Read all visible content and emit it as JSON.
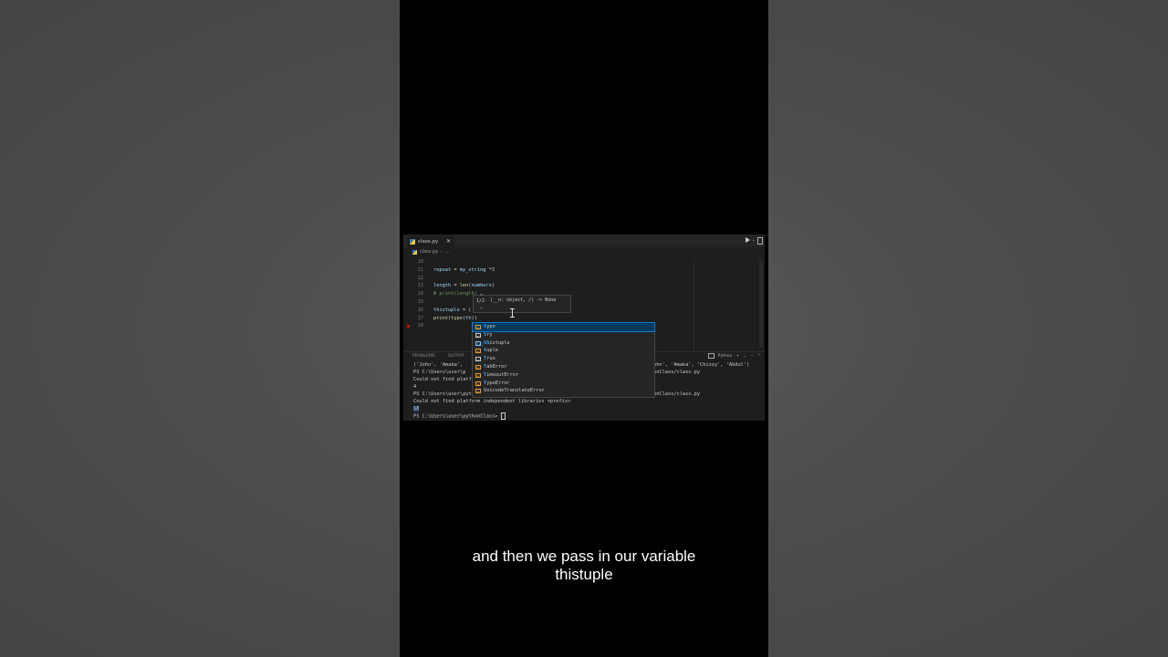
{
  "editor_tab": {
    "filename": "class.py",
    "close_glyph": "✕"
  },
  "breadcrumb": {
    "file": "class.py",
    "sep": "›",
    "rest": "..."
  },
  "toolbar": {
    "chevron": "⌄"
  },
  "code_lines": [
    {
      "num": "10",
      "tokens": []
    },
    {
      "num": "11",
      "tokens": [
        {
          "t": "repeat",
          "c": "kw-var"
        },
        {
          "t": " = ",
          "c": "kw-pl"
        },
        {
          "t": "my_string",
          "c": "kw-var"
        },
        {
          "t": " *",
          "c": "kw-pl"
        },
        {
          "t": "3",
          "c": "kw-num"
        }
      ]
    },
    {
      "num": "12",
      "tokens": []
    },
    {
      "num": "13",
      "tokens": [
        {
          "t": "length",
          "c": "kw-var"
        },
        {
          "t": " = ",
          "c": "kw-pl"
        },
        {
          "t": "len",
          "c": "kw-fn"
        },
        {
          "t": "(",
          "c": "kw-pl"
        },
        {
          "t": "numbers",
          "c": "kw-var"
        },
        {
          "t": ")",
          "c": "kw-pl"
        }
      ]
    },
    {
      "num": "14",
      "tokens": [
        {
          "t": "# print(length)",
          "c": "kw-cm"
        }
      ]
    },
    {
      "num": "15",
      "tokens": []
    },
    {
      "num": "16",
      "tokens": [
        {
          "t": "thistuple",
          "c": "kw-var"
        },
        {
          "t": " = (",
          "c": "kw-pl"
        }
      ]
    },
    {
      "num": "17",
      "tokens": [
        {
          "t": "print",
          "c": "kw-fn"
        },
        {
          "t": "(",
          "c": "kw-pl"
        },
        {
          "t": "type",
          "c": "kw-fn"
        },
        {
          "t": "(",
          "c": "kw-pl"
        },
        {
          "t": "th",
          "c": "kw-var"
        },
        {
          "t": "))",
          "c": "kw-pl"
        }
      ]
    },
    {
      "num": "18",
      "tokens": []
    }
  ],
  "signature_hover": {
    "page": "1/2",
    "up": "^",
    "down": "⌄",
    "signature": "(__o: object, /) -> None"
  },
  "suggestions": [
    {
      "icon": "⊞",
      "kind": "cls",
      "match": "t",
      "rest": "ype",
      "selected": true
    },
    {
      "icon": "≡",
      "kind": "kw",
      "match": "t",
      "rest": "ry",
      "selected": false
    },
    {
      "icon": "[x]",
      "kind": "var",
      "match": "th",
      "rest": "istuple",
      "selected": false
    },
    {
      "icon": "⊞",
      "kind": "cls",
      "match": "t",
      "rest": "uple",
      "selected": false
    },
    {
      "icon": "≡",
      "kind": "kw",
      "match": "T",
      "rest": "rue",
      "selected": false
    },
    {
      "icon": "⊞",
      "kind": "cls",
      "match": "T",
      "rest": "abError",
      "selected": false
    },
    {
      "icon": "⊞",
      "kind": "cls",
      "match": "T",
      "rest": "imeoutError",
      "selected": false
    },
    {
      "icon": "⊞",
      "kind": "cls",
      "match": "T",
      "rest": "ypeError",
      "selected": false
    },
    {
      "icon": "⊞",
      "kind": "cls",
      "match": "",
      "rest": "UnicodeTranslateError",
      "selected": false
    }
  ],
  "panel": {
    "tabs": [
      "PROBLEMS",
      "OUTPUT"
    ],
    "terminal_label": "Python",
    "add": "+",
    "chevron": "⌄",
    "more": "···",
    "collapse": "^"
  },
  "terminal": {
    "lines": [
      "('John', 'Amaka',",
      "PS C:\\Users\\user\\p",
      "Could not find platf",
      "4",
      "PS C:\\Users\\user\\pythonClass>",
      "Could not find platform independent libraries <prefix>",
      "18",
      "PS C:\\Users\\user\\pythonClass>"
    ],
    "right_fragments": [
      "ohn', 'Amaka', 'Chizzy', 'Abdul')",
      "onClass/class.py",
      "onClass/class.py"
    ]
  },
  "caption": {
    "line1": "and then we pass in our variable",
    "line2": "thistuple"
  }
}
